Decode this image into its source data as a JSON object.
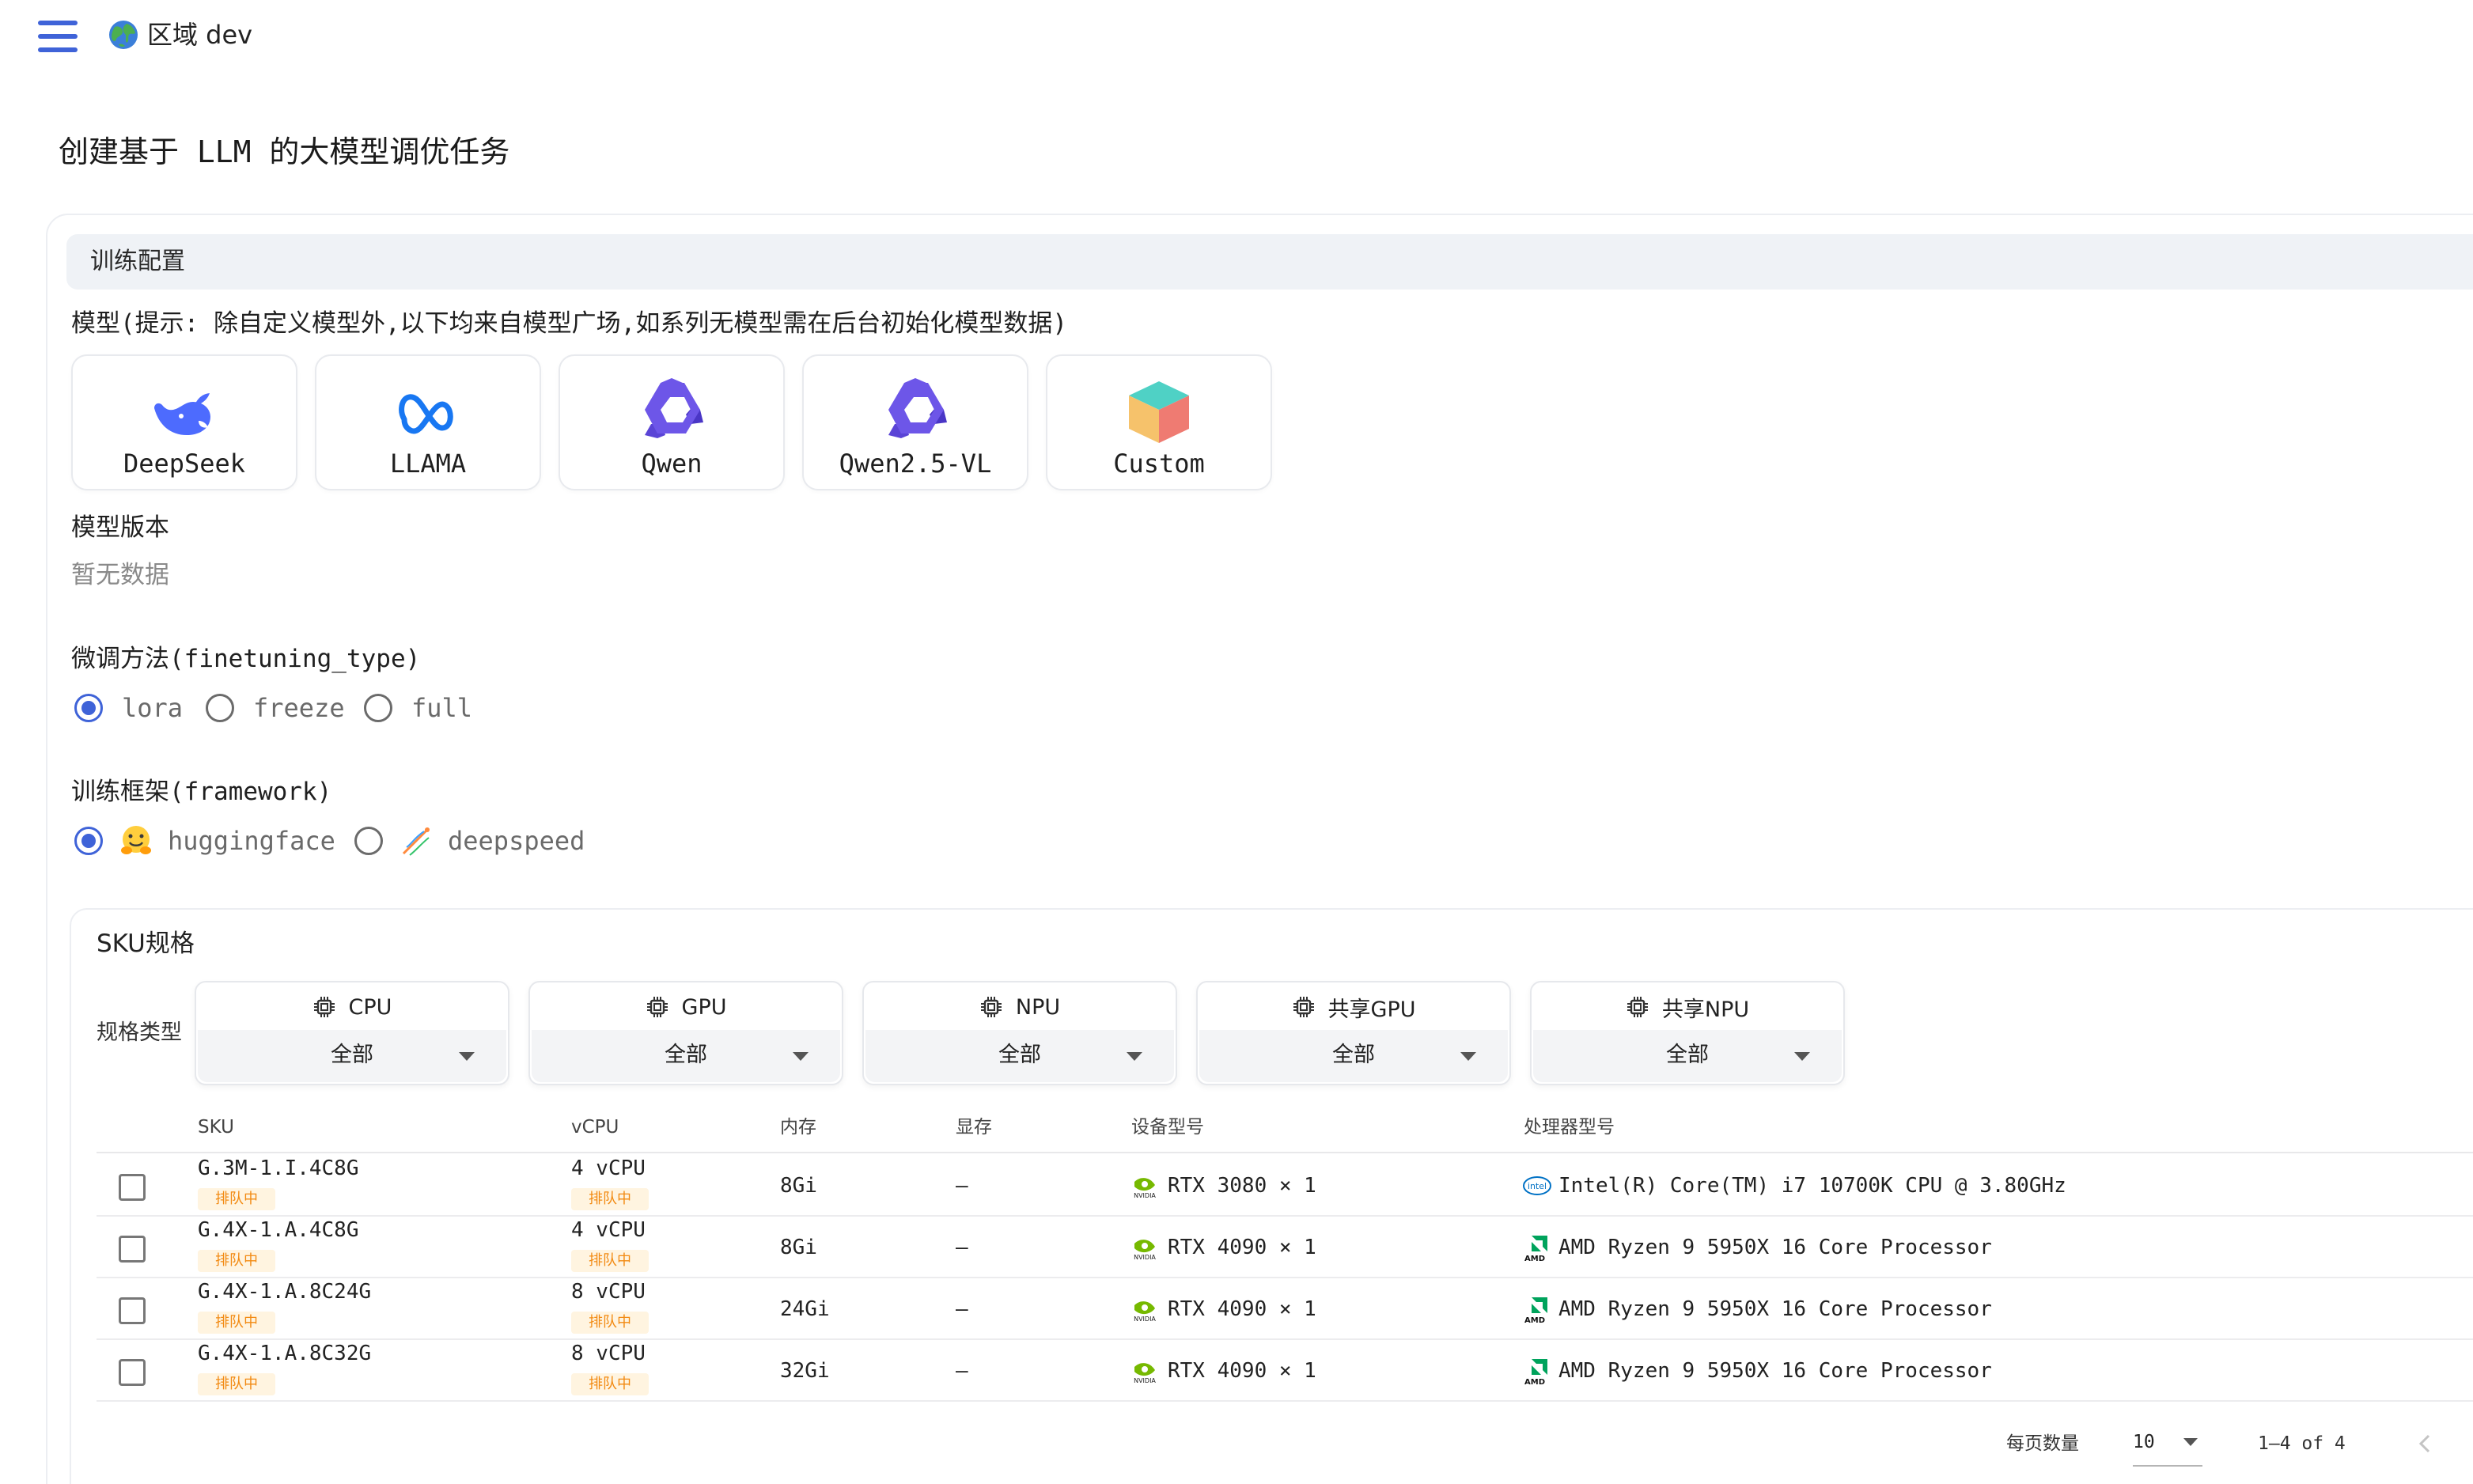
{
  "header": {
    "menu_icon": "hamburger-menu-icon",
    "region_icon": "globe-icon",
    "region_label": "区域 dev"
  },
  "page": {
    "title": "创建基于 LLM 的大模型调优任务"
  },
  "training": {
    "section_title": "训练配置",
    "model_label": "模型(提示: 除自定义模型外,以下均来自模型广场,如系列无模型需在后台初始化模型数据)",
    "models": [
      {
        "name": "DeepSeek",
        "icon": "deepseek-whale-icon"
      },
      {
        "name": "LLAMA",
        "icon": "meta-infinity-icon"
      },
      {
        "name": "Qwen",
        "icon": "qwen-icon"
      },
      {
        "name": "Qwen2.5-VL",
        "icon": "qwen-icon"
      },
      {
        "name": "Custom",
        "icon": "cube-icon"
      }
    ],
    "version_label": "模型版本",
    "version_empty": "暂无数据",
    "finetune_label": "微调方法(finetuning_type)",
    "finetune_options": [
      "lora",
      "freeze",
      "full"
    ],
    "finetune_selected": "lora",
    "framework_label": "训练框架(framework)",
    "framework_options": [
      "huggingface",
      "deepspeed"
    ],
    "framework_selected": "huggingface"
  },
  "sku": {
    "title": "SKU规格",
    "spec_type_label": "规格类型",
    "filters": [
      {
        "label": "CPU",
        "value": "全部",
        "icon": "chip-icon"
      },
      {
        "label": "GPU",
        "value": "全部",
        "icon": "chip-icon"
      },
      {
        "label": "NPU",
        "value": "全部",
        "icon": "chip-icon"
      },
      {
        "label": "共享GPU",
        "value": "全部",
        "icon": "chip-icon"
      },
      {
        "label": "共享NPU",
        "value": "全部",
        "icon": "chip-icon"
      }
    ],
    "columns": [
      "SKU",
      "vCPU",
      "内存",
      "显存",
      "设备型号",
      "处理器型号"
    ],
    "rows": [
      {
        "sku": "G.3M-1.I.4C8G",
        "sku_tag": "排队中",
        "vcpu": "4 vCPU",
        "vcpu_tag": "排队中",
        "memory": "8Gi",
        "gpu_memory": "–",
        "device": "RTX 3080 × 1",
        "device_icon": "nvidia-icon",
        "processor": "Intel(R) Core(TM) i7 10700K CPU @ 3.80GHz",
        "processor_icon": "intel-icon"
      },
      {
        "sku": "G.4X-1.A.4C8G",
        "sku_tag": "排队中",
        "vcpu": "4 vCPU",
        "vcpu_tag": "排队中",
        "memory": "8Gi",
        "gpu_memory": "–",
        "device": "RTX 4090 × 1",
        "device_icon": "nvidia-icon",
        "processor": "AMD Ryzen 9 5950X 16 Core Processor",
        "processor_icon": "amd-icon"
      },
      {
        "sku": "G.4X-1.A.8C24G",
        "sku_tag": "排队中",
        "vcpu": "8 vCPU",
        "vcpu_tag": "排队中",
        "memory": "24Gi",
        "gpu_memory": "–",
        "device": "RTX 4090 × 1",
        "device_icon": "nvidia-icon",
        "processor": "AMD Ryzen 9 5950X 16 Core Processor",
        "processor_icon": "amd-icon"
      },
      {
        "sku": "G.4X-1.A.8C32G",
        "sku_tag": "排队中",
        "vcpu": "8 vCPU",
        "vcpu_tag": "排队中",
        "memory": "32Gi",
        "gpu_memory": "–",
        "device": "RTX 4090 × 1",
        "device_icon": "nvidia-icon",
        "processor": "AMD Ryzen 9 5950X 16 Core Processor",
        "processor_icon": "amd-icon"
      }
    ],
    "pagination": {
      "per_page_label": "每页数量",
      "per_page_value": "10",
      "range": "1–4 of 4",
      "prev_icon": "chevron-left-icon"
    }
  },
  "colors": {
    "accent": "#3f63d8",
    "tag_bg": "#fff4e0",
    "tag_text": "#f28a12",
    "nvidia": "#76b900",
    "amd": "#00a35c",
    "intel": "#0071c5"
  }
}
